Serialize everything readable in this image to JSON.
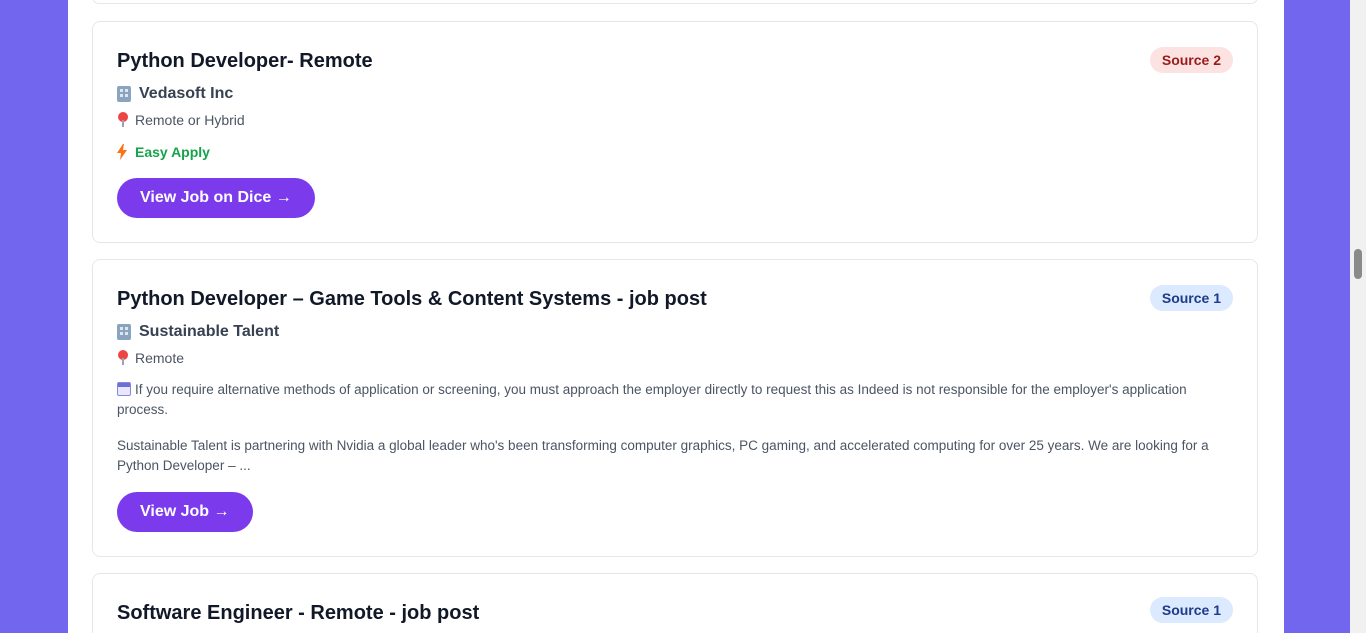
{
  "jobs": [
    {
      "title": "Python Developer- Remote",
      "badge": "Source 2",
      "company_icon": "office-building-icon",
      "company": "Vedasoft Inc",
      "location_icon": "map-pin-icon",
      "location": "Remote or Hybrid",
      "easy_apply_icon": "lightning-bolt-icon",
      "easy_apply": "Easy Apply",
      "button": "View Job on Dice →"
    },
    {
      "title": "Python Developer – Game Tools & Content Systems - job post",
      "badge": "Source 1",
      "company_icon": "office-building-icon",
      "company": "Sustainable Talent",
      "location_icon": "map-pin-icon",
      "location": "Remote",
      "note_icon": "calendar-icon",
      "note": "If you require alternative methods of application or screening, you must approach the employer directly to request this as Indeed is not responsible for the employer's application process.",
      "description": "Sustainable Talent is partnering with Nvidia a global leader who's been transforming computer graphics, PC gaming, and accelerated computing for over 25 years. We are looking for a Python Developer – ...",
      "button": "View Job →"
    },
    {
      "title": "Software Engineer - Remote - job post",
      "badge": "Source 1"
    }
  ],
  "colors": {
    "page_background": "#7266ee",
    "button": "#7c3aed",
    "easy_apply": "#16a34a",
    "source2_badge_bg": "#fde2e2",
    "source1_badge_bg": "#dbeafe"
  }
}
